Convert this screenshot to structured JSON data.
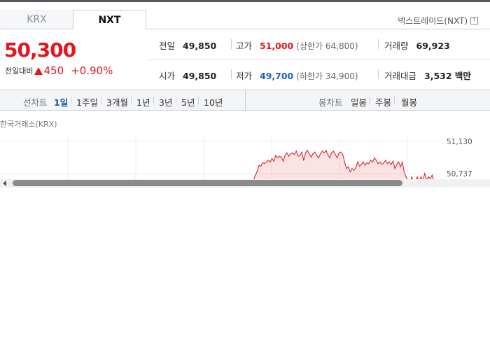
{
  "tabs": [
    {
      "label": "KRX",
      "active": false
    },
    {
      "label": "NXT",
      "active": true
    }
  ],
  "nxt_link": {
    "label": "넥스트레이드(NXT)",
    "icon": "help-icon",
    "icon_glyph": "?"
  },
  "quote": {
    "price": "50,300",
    "diff_label": "전일대비",
    "diff_icon": "up-triangle-icon",
    "diff": "450",
    "rate": "+0.90%"
  },
  "stats": {
    "prev_close": {
      "label": "전일",
      "value": "49,850"
    },
    "high": {
      "label": "고가",
      "value": "51,000",
      "sub": "(상한가 64,800)"
    },
    "volume": {
      "label": "거래량",
      "value": "69,923"
    },
    "open": {
      "label": "시가",
      "value": "49,850"
    },
    "low": {
      "label": "저가",
      "value": "49,700",
      "sub": "(하한가 34,900)"
    },
    "amount": {
      "label": "거래대금",
      "value": "3,532 백만"
    }
  },
  "period_bar": {
    "line_label": "선차트",
    "line_options": [
      "1일",
      "1주일",
      "3개월",
      "1년",
      "3년",
      "5년",
      "10년"
    ],
    "active": "1일",
    "candle_label": "봉차트",
    "candle_options": [
      "일봉",
      "주봉",
      "월봉"
    ]
  },
  "chart_source": "한국거래소(KRX)",
  "colors": {
    "up": "#e2161d",
    "down": "#1a5fc2",
    "active_period": "#1a4fb0"
  },
  "chart_data": {
    "type": "line",
    "title": "",
    "xlabel": "",
    "ylabel": "",
    "ylim": [
      50620,
      51180
    ],
    "y_ticks": [
      "51,130",
      "50,737"
    ],
    "grid": true,
    "series": [
      {
        "values": [
          50650,
          50720,
          50760,
          50840,
          50830,
          50870,
          50860,
          50880,
          50900,
          50880,
          50920,
          50890,
          50960,
          50930,
          50950,
          50940,
          50890,
          50960,
          50990,
          50950,
          50980,
          50990,
          50970,
          51010,
          50950,
          50960,
          51000,
          50900,
          50990,
          51020,
          50980,
          50940,
          50980,
          51000,
          50960,
          50930,
          50980,
          51010,
          50990,
          51020,
          50970,
          50930,
          50990,
          51010,
          50970,
          50930,
          50990,
          51000,
          50970,
          50880,
          50800,
          50820,
          50760,
          50800,
          50780,
          50810,
          50880,
          50830,
          50850,
          50880,
          50840,
          50870,
          50860,
          50900,
          50880,
          50930,
          50900,
          50860,
          50880,
          50850,
          50870,
          50900,
          50860,
          50880,
          50850,
          50890,
          50800,
          50850,
          50880,
          50820,
          50880,
          50760,
          50700,
          50650,
          50620,
          50700,
          50650,
          50640,
          50700,
          50640,
          50700,
          50650,
          50740,
          50660,
          50700,
          50680,
          50720,
          50640
        ]
      }
    ]
  }
}
